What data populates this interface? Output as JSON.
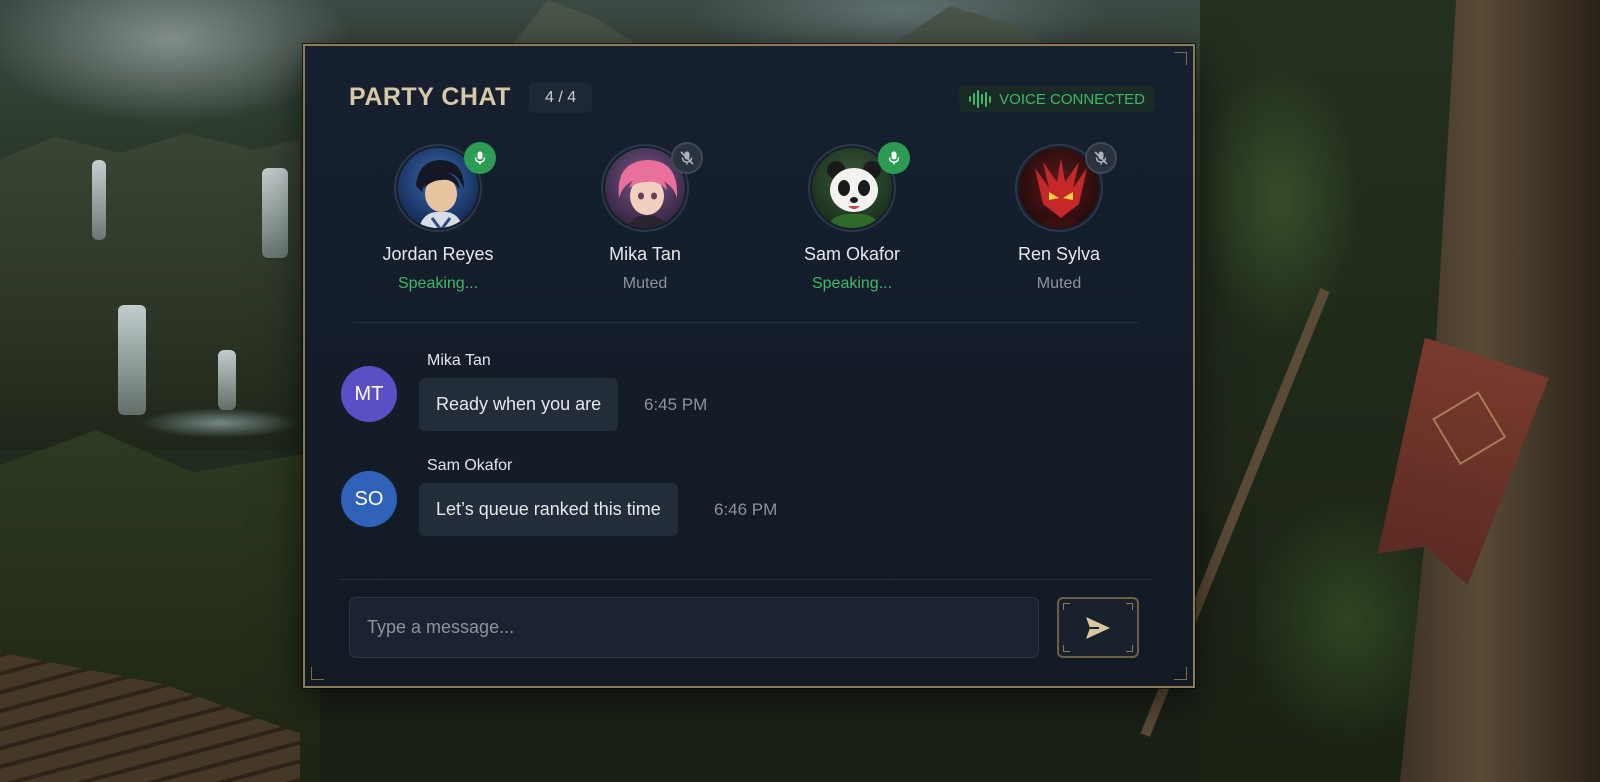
{
  "panel": {
    "title": "PARTY CHAT",
    "count": "4 / 4",
    "voice_status": "VOICE CONNECTED"
  },
  "members": [
    {
      "name": "Jordan Reyes",
      "status": "Speaking...",
      "mic": "mic-on-icon"
    },
    {
      "name": "Mika Tan",
      "status": "Muted",
      "mic": "mic-muted-icon"
    },
    {
      "name": "Sam Okafor",
      "status": "Speaking...",
      "mic": "mic-on-icon"
    },
    {
      "name": "Ren Sylva",
      "status": "Muted",
      "mic": "mic-muted-icon"
    }
  ],
  "messages": [
    {
      "initials": "MT",
      "sender": "Mika Tan",
      "text": "Ready when you are",
      "time": "6:45 PM",
      "color": "#5a4fc4"
    },
    {
      "initials": "SO",
      "sender": "Sam Okafor",
      "text": "Let’s queue ranked this time",
      "time": "6:46 PM",
      "color": "#2f62b8"
    }
  ],
  "composer": {
    "placeholder": "Type a message..."
  },
  "colors": {
    "accent_gold": "#8d7b55",
    "speaking_green": "#3fb868",
    "panel_bg": "#141c28"
  }
}
